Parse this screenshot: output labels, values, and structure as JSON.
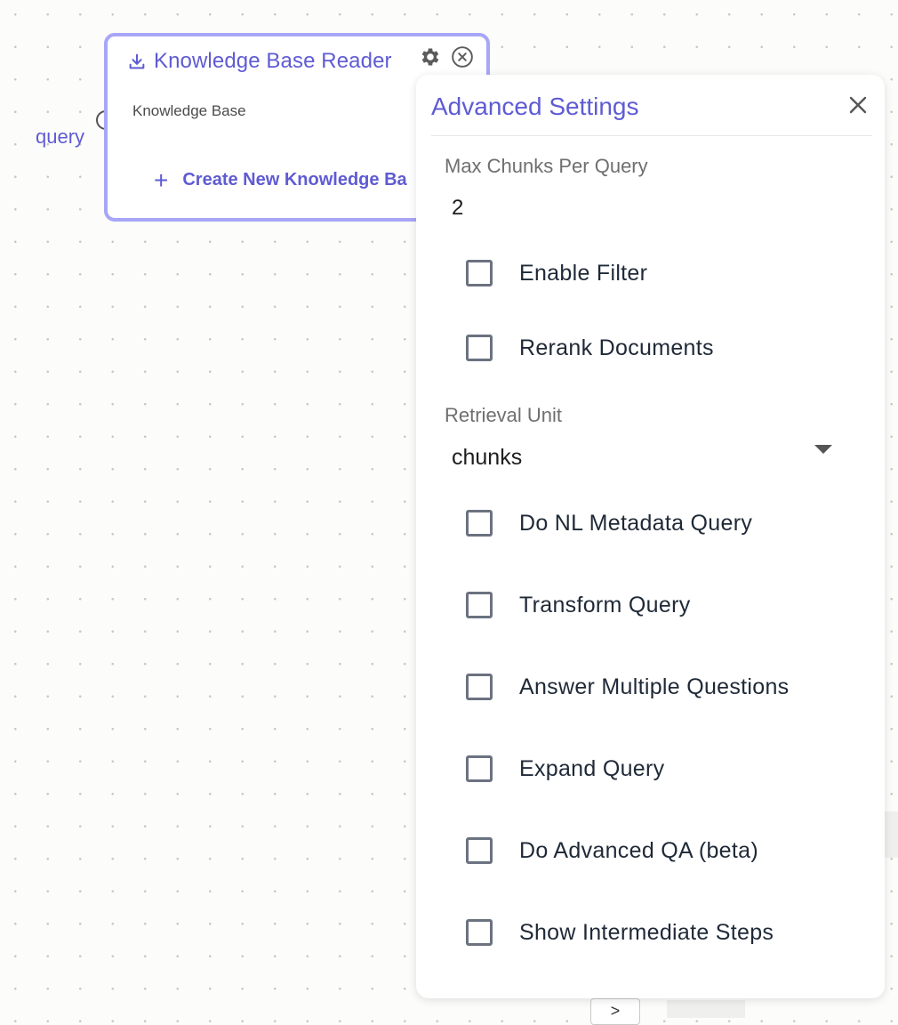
{
  "canvas": {
    "node": {
      "title": "Knowledge Base Reader",
      "field_label": "Knowledge Base",
      "create_label": "Create New Knowledge Ba",
      "input_port_label": "query"
    },
    "bottom_button_label": ">"
  },
  "panel": {
    "title": "Advanced Settings",
    "max_chunks": {
      "label": "Max Chunks Per Query",
      "value": "2"
    },
    "checks_top": [
      {
        "label": "Enable Filter",
        "checked": false
      },
      {
        "label": "Rerank Documents",
        "checked": false
      }
    ],
    "retrieval_unit": {
      "label": "Retrieval Unit",
      "value": "chunks"
    },
    "checks_bottom": [
      {
        "label": "Do NL Metadata Query",
        "checked": false
      },
      {
        "label": "Transform Query",
        "checked": false
      },
      {
        "label": "Answer Multiple Questions",
        "checked": false
      },
      {
        "label": "Expand Query",
        "checked": false
      },
      {
        "label": "Do Advanced QA (beta)",
        "checked": false
      },
      {
        "label": "Show Intermediate Steps",
        "checked": false
      }
    ]
  },
  "colors": {
    "accent": "#5f5bd3",
    "node_border": "#a8a6f7"
  },
  "icons": {
    "node_type": "download-icon",
    "settings": "gear-icon",
    "remove": "close-circle-icon",
    "panel_close": "close-icon"
  }
}
